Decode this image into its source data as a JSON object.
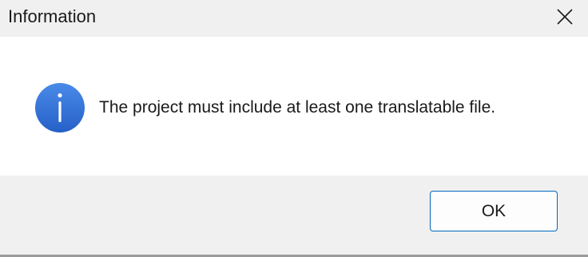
{
  "window": {
    "title": "Information"
  },
  "titlebar": {
    "close_icon": "close-icon"
  },
  "content": {
    "icon": "info-icon",
    "message": "The project must include at least one translatable file."
  },
  "footer": {
    "ok_label": "OK"
  },
  "colors": {
    "icon_blue": "#2f6fd6",
    "button_border": "#0067c0",
    "content_bg": "#ffffff",
    "chrome_bg": "#f0f0f0"
  }
}
